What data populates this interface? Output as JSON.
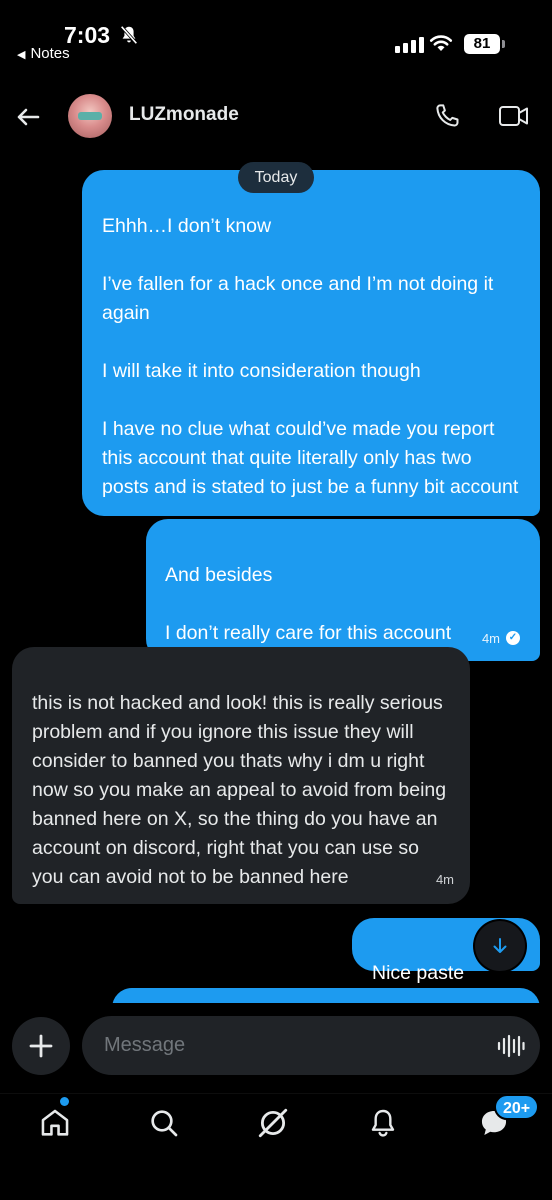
{
  "status_bar": {
    "time": "7:03",
    "back_app": "Notes",
    "battery": "81"
  },
  "header": {
    "contact_name": "LUZmonade"
  },
  "conversation": {
    "date_separator": "Today",
    "messages": [
      {
        "direction": "outgoing",
        "text": "Ehhh…I don’t know\n\nI’ve fallen for a hack once and I’m not doing it again\n\nI will take it into consideration though\n\nI have no clue what could’ve made you report this account that quite literally only has two posts and is stated to just be a funny bit account"
      },
      {
        "direction": "outgoing",
        "text": "And besides\n\nI don’t really care for this account",
        "time": "4m"
      },
      {
        "direction": "incoming",
        "text": "this is not hacked and look! this is really serious problem and if you ignore this issue they will consider to banned you thats why i dm u right now so you make an appeal to avoid from being banned here on X, so the thing do you have an account on discord, right that you can use so you can avoid not to be banned here",
        "time": "4m"
      },
      {
        "direction": "outgoing",
        "text": "Nice paste"
      }
    ]
  },
  "composer": {
    "placeholder": "Message"
  },
  "tabbar": {
    "items": [
      "home-icon",
      "search-icon",
      "grok-icon",
      "notifications-icon",
      "messages-icon"
    ],
    "messages_badge": "20+"
  },
  "colors": {
    "accent": "#1d9bf0",
    "incoming_bubble": "#202327",
    "background": "#000000"
  }
}
